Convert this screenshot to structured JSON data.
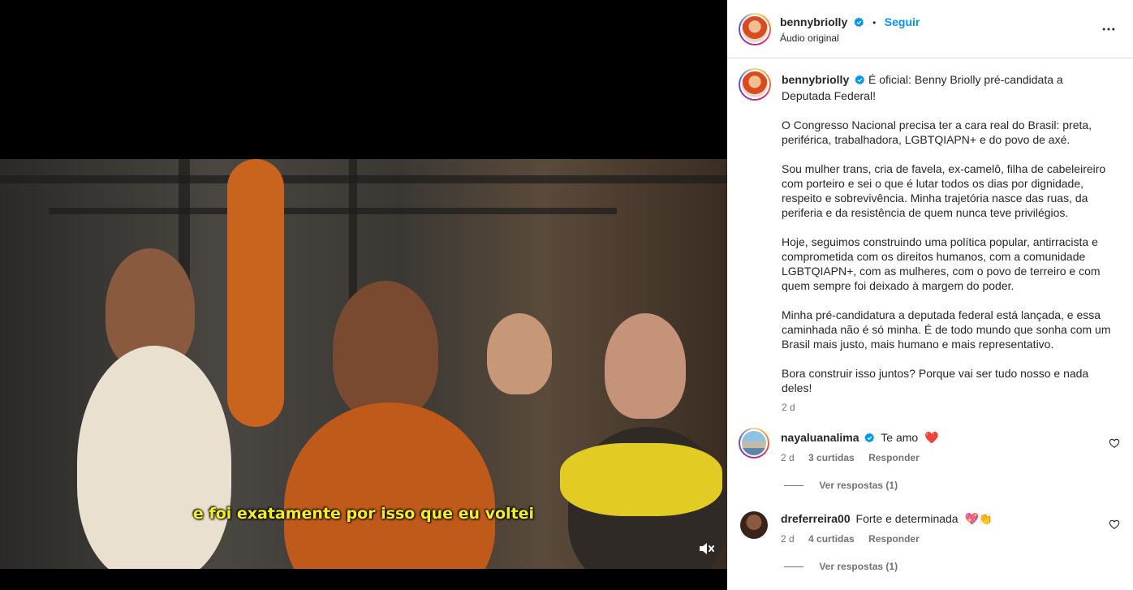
{
  "video": {
    "subtitle": "e foi exatamente por isso que eu voltei",
    "mute_icon": "speaker-muted-icon"
  },
  "header": {
    "username": "bennybriolly",
    "separator": "•",
    "follow_label": "Seguir",
    "audio_label": "Áudio original",
    "more_icon": "more-horizontal-icon"
  },
  "caption": {
    "username": "bennybriolly",
    "lead": "É oficial: Benny Briolly pré-candidata a Deputada Federal!",
    "paragraphs": [
      "O Congresso Nacional precisa ter a cara real do Brasil: preta, periférica, trabalhadora, LGBTQIAPN+ e do povo de axé.",
      "Sou mulher trans, cria de favela, ex-camelô, filha de cabeleireiro com porteiro e sei o que é lutar todos os dias por dignidade, respeito e sobrevivência. Minha trajetória nasce das ruas, da periferia e da resistência de quem nunca teve privilégios.",
      "Hoje, seguimos construindo uma política popular, antirracista e comprometida com os direitos humanos, com a comunidade LGBTQIAPN+, com as mulheres, com o povo de terreiro e com quem sempre foi deixado à margem do poder.",
      "Minha pré-candidatura a deputada federal está lançada, e essa caminhada não é só minha. É de todo mundo que sonha com um Brasil mais justo, mais humano e mais representativo.",
      "Bora construir isso juntos? Porque vai ser tudo nosso e nada deles!"
    ],
    "time": "2 d"
  },
  "comments": [
    {
      "username": "nayaluanalima",
      "verified": true,
      "text": "Te amo",
      "emoji": "❤️",
      "time": "2 d",
      "likes": "3 curtidas",
      "reply_label": "Responder",
      "view_replies": "Ver respostas (1)"
    },
    {
      "username": "dreferreira00",
      "verified": false,
      "text": "Forte e determinada",
      "emoji": "💖👏",
      "time": "2 d",
      "likes": "4 curtidas",
      "reply_label": "Responder",
      "view_replies": "Ver respostas (1)"
    }
  ],
  "colors": {
    "link_blue": "#0095f6",
    "verified_blue": "#0095f6",
    "subtitle_yellow": "#f4f01e",
    "muted_text": "#737373"
  }
}
